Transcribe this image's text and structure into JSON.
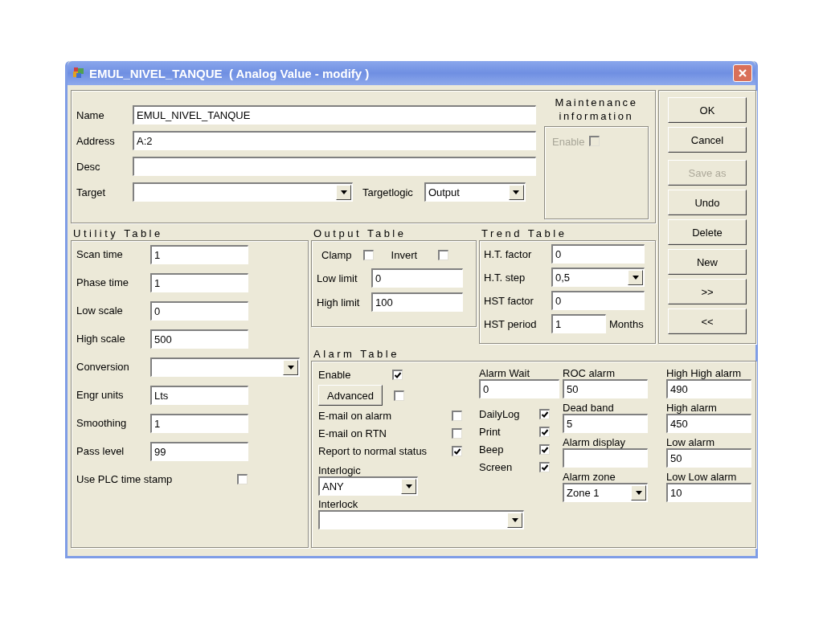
{
  "window": {
    "title": "EMUL_NIVEL_TANQUE  ( Analog Value - modify )"
  },
  "general": {
    "fields": [
      {
        "label": "Name",
        "kind": "text",
        "value": "EMUL_NIVEL_TANQUE"
      },
      {
        "label": "Address",
        "kind": "text",
        "value": "A:2"
      },
      {
        "label": "Desc",
        "kind": "text"
      }
    ],
    "target": {
      "label": "Target",
      "kind": "dropdown"
    },
    "targetlogic": {
      "label": "Targetlogic",
      "kind": "dropdown",
      "value": "Output"
    }
  },
  "maintenance": {
    "title": "Maintenance information",
    "enable": {
      "label": "Enable",
      "checked": false,
      "disabled": true
    }
  },
  "buttons": [
    {
      "label": "OK",
      "disabled": false
    },
    {
      "label": "Cancel",
      "disabled": false
    },
    {
      "label": "Save as",
      "disabled": true
    },
    {
      "label": "Undo",
      "disabled": false
    },
    {
      "label": "Delete",
      "disabled": false
    },
    {
      "label": "New",
      "disabled": false
    },
    {
      "label": ">>",
      "disabled": false
    },
    {
      "label": "<<",
      "disabled": false
    }
  ],
  "utility_table": {
    "title": "Utility Table",
    "fields": [
      {
        "label": "Scan time",
        "kind": "text",
        "value": "1"
      },
      {
        "label": "Phase time",
        "kind": "text",
        "value": "1"
      },
      {
        "label": "Low scale",
        "kind": "text",
        "value": "0"
      },
      {
        "label": "High scale",
        "kind": "text",
        "value": "500"
      },
      {
        "label": "Conversion",
        "kind": "dropdown"
      },
      {
        "label": "Engr units",
        "kind": "text",
        "value": "Lts"
      },
      {
        "label": "Smoothing",
        "kind": "text",
        "value": "1"
      },
      {
        "label": "Pass level",
        "kind": "text",
        "value": "99"
      },
      {
        "label": "Use PLC time stamp",
        "kind": "checkbox",
        "checked": false
      }
    ]
  },
  "output_table": {
    "title": "Output Table",
    "checks": [
      {
        "label": "Clamp",
        "checked": false
      },
      {
        "label": "Invert",
        "checked": false
      }
    ],
    "fields": [
      {
        "label": "Low limit",
        "kind": "text",
        "value": "0"
      },
      {
        "label": "High limit",
        "kind": "text",
        "value": "100"
      }
    ]
  },
  "trend_table": {
    "title": "Trend Table",
    "fields": [
      {
        "label": "H.T. factor",
        "kind": "text",
        "value": "0"
      },
      {
        "label": "H.T. step",
        "kind": "dropdown",
        "value": "0,5"
      },
      {
        "label": "HST factor",
        "kind": "text",
        "value": "0"
      },
      {
        "label": "HST period",
        "kind": "text",
        "value": "1",
        "unit": "Months"
      }
    ]
  },
  "alarm_table": {
    "title": "Alarm Table",
    "enable": {
      "label": "Enable",
      "checked": true
    },
    "advanced": {
      "label": "Advanced",
      "checked": false
    },
    "notify": [
      {
        "label": "E-mail on alarm",
        "checked": false
      },
      {
        "label": "E-mail on RTN",
        "checked": false
      },
      {
        "label": "Report to normal status",
        "checked": true
      }
    ],
    "interlogic": {
      "label": "Interlogic",
      "kind": "dropdown",
      "value": "ANY"
    },
    "interlock": {
      "label": "Interlock",
      "kind": "dropdown"
    },
    "alarm_wait": {
      "label": "Alarm Wait",
      "kind": "text",
      "value": "0"
    },
    "outputs": [
      {
        "label": "DailyLog",
        "checked": true
      },
      {
        "label": "Print",
        "checked": true
      },
      {
        "label": "Beep",
        "checked": true
      },
      {
        "label": "Screen",
        "checked": true
      }
    ],
    "settings": [
      {
        "label": "ROC alarm",
        "kind": "text",
        "value": "50"
      },
      {
        "label": "Dead band",
        "kind": "text",
        "value": "5"
      },
      {
        "label": "Alarm display",
        "kind": "text"
      },
      {
        "label": "Alarm zone",
        "kind": "dropdown",
        "value": "Zone 1"
      }
    ],
    "levels": [
      {
        "label": "High High alarm",
        "kind": "text",
        "value": "490"
      },
      {
        "label": "High alarm",
        "kind": "text",
        "value": "450"
      },
      {
        "label": "Low alarm",
        "kind": "text",
        "value": "50"
      },
      {
        "label": "Low Low alarm",
        "kind": "text",
        "value": "10"
      }
    ]
  }
}
